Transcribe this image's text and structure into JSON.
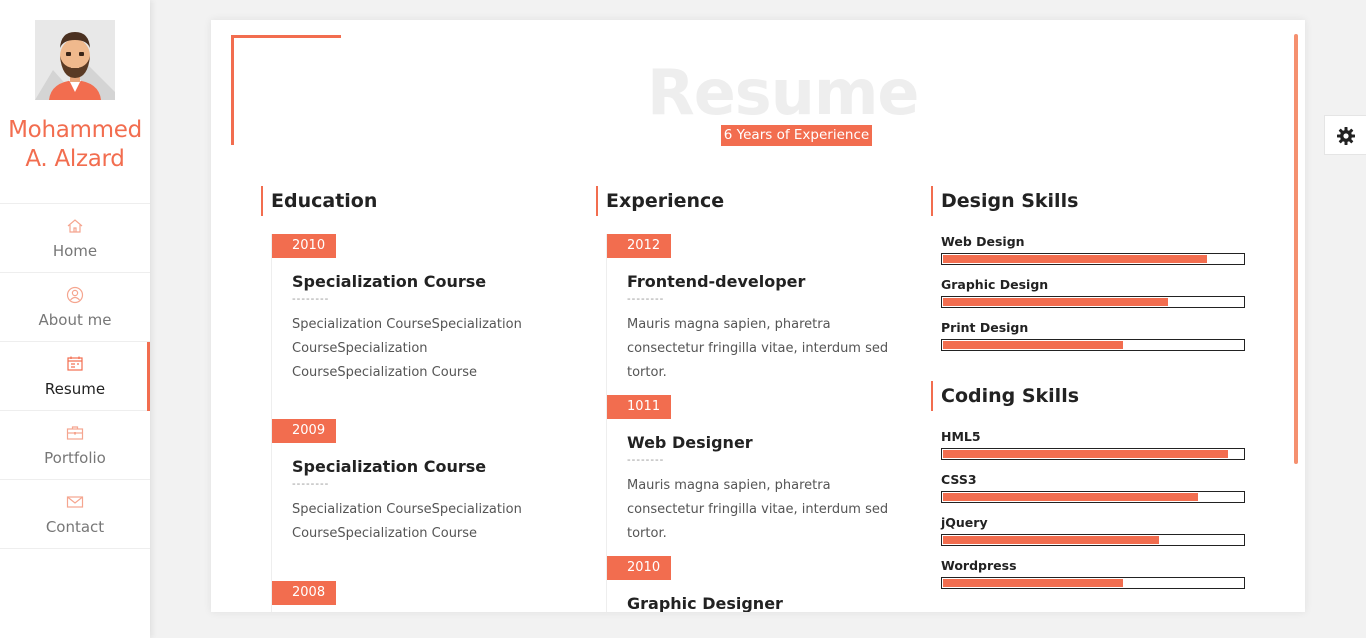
{
  "profile": {
    "name_line1": "Mohammed",
    "name_line2": "A. Alzard"
  },
  "nav": [
    {
      "label": "Home",
      "icon": "home-icon"
    },
    {
      "label": "About me",
      "icon": "user-icon"
    },
    {
      "label": "Resume",
      "icon": "resume-icon",
      "active": true
    },
    {
      "label": "Portfolio",
      "icon": "briefcase-icon"
    },
    {
      "label": "Contact",
      "icon": "envelope-icon"
    }
  ],
  "resume": {
    "title": "Resume",
    "experience_badge": "6 Years of Experience"
  },
  "education": {
    "heading": "Education",
    "items": [
      {
        "year": "2010",
        "title": "Specialization Course",
        "dash": "--------",
        "desc": "Specialization CourseSpecialization CourseSpecialization CourseSpecialization Course"
      },
      {
        "year": "2009",
        "title": "Specialization Course",
        "dash": "--------",
        "desc": "Specialization CourseSpecialization CourseSpecialization Course"
      },
      {
        "year": "2008",
        "title": "",
        "dash": "",
        "desc": ""
      }
    ]
  },
  "experience": {
    "heading": "Experience",
    "items": [
      {
        "year": "2012",
        "title": "Frontend-developer",
        "dash": "--------",
        "desc": "Mauris magna sapien, pharetra consectetur fringilla vitae, interdum sed tortor."
      },
      {
        "year": "1011",
        "title": "Web Designer",
        "dash": "--------",
        "desc": "Mauris magna sapien, pharetra consectetur fringilla vitae, interdum sed tortor."
      },
      {
        "year": "2010",
        "title": "Graphic Designer",
        "dash": "",
        "desc": ""
      }
    ]
  },
  "design_skills": {
    "heading": "Design Skills",
    "items": [
      {
        "name": "Web Design",
        "level": 0.88
      },
      {
        "name": "Graphic Design",
        "level": 0.75
      },
      {
        "name": "Print Design",
        "level": 0.6
      }
    ]
  },
  "coding_skills": {
    "heading": "Coding Skills",
    "items": [
      {
        "name": "HML5",
        "level": 0.95
      },
      {
        "name": "CSS3",
        "level": 0.85
      },
      {
        "name": "jQuery",
        "level": 0.72
      },
      {
        "name": "Wordpress",
        "level": 0.6
      }
    ]
  },
  "colors": {
    "accent": "#f26d4f"
  }
}
